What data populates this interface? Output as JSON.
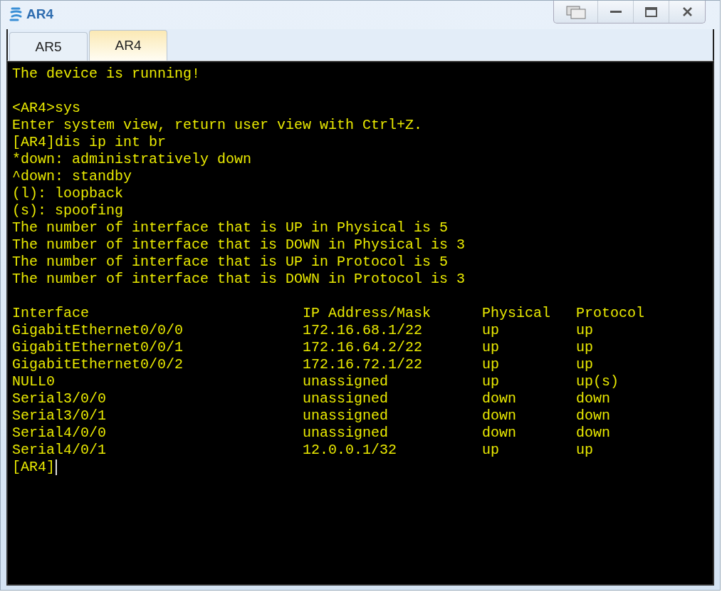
{
  "window": {
    "title": "AR4"
  },
  "tabs": [
    {
      "label": "AR5",
      "selected": false
    },
    {
      "label": "AR4",
      "selected": true
    }
  ],
  "terminal": {
    "lines_before": [
      {
        "kind": "text",
        "text": "The device is running!"
      },
      {
        "kind": "blank"
      },
      {
        "kind": "text",
        "text": "<AR4>sys"
      },
      {
        "kind": "text",
        "text": "Enter system view, return user view with Ctrl+Z."
      },
      {
        "kind": "text",
        "text": "[AR4]dis ip int br"
      },
      {
        "kind": "text",
        "text": "*down: administratively down"
      },
      {
        "kind": "text",
        "text": "^down: standby"
      },
      {
        "kind": "text",
        "text": "(l): loopback"
      },
      {
        "kind": "text",
        "text": "(s): spoofing"
      },
      {
        "kind": "text",
        "text": "The number of interface that is UP in Physical is 5"
      },
      {
        "kind": "text",
        "text": "The number of interface that is DOWN in Physical is 3"
      },
      {
        "kind": "text",
        "text": "The number of interface that is UP in Protocol is 5"
      },
      {
        "kind": "text",
        "text": "The number of interface that is DOWN in Protocol is 3"
      },
      {
        "kind": "blank"
      }
    ],
    "table": {
      "columns": [
        "Interface",
        "IP Address/Mask",
        "Physical",
        "Protocol"
      ],
      "rows": [
        [
          "GigabitEthernet0/0/0",
          "172.16.68.1/22",
          "up",
          "up"
        ],
        [
          "GigabitEthernet0/0/1",
          "172.16.64.2/22",
          "up",
          "up"
        ],
        [
          "GigabitEthernet0/0/2",
          "172.16.72.1/22",
          "up",
          "up"
        ],
        [
          "NULL0",
          "unassigned",
          "up",
          "up(s)"
        ],
        [
          "Serial3/0/0",
          "unassigned",
          "down",
          "down"
        ],
        [
          "Serial3/0/1",
          "unassigned",
          "down",
          "down"
        ],
        [
          "Serial4/0/0",
          "unassigned",
          "down",
          "down"
        ],
        [
          "Serial4/0/1",
          "12.0.0.1/32",
          "up",
          "up"
        ]
      ]
    },
    "prompt": "[AR4]"
  }
}
